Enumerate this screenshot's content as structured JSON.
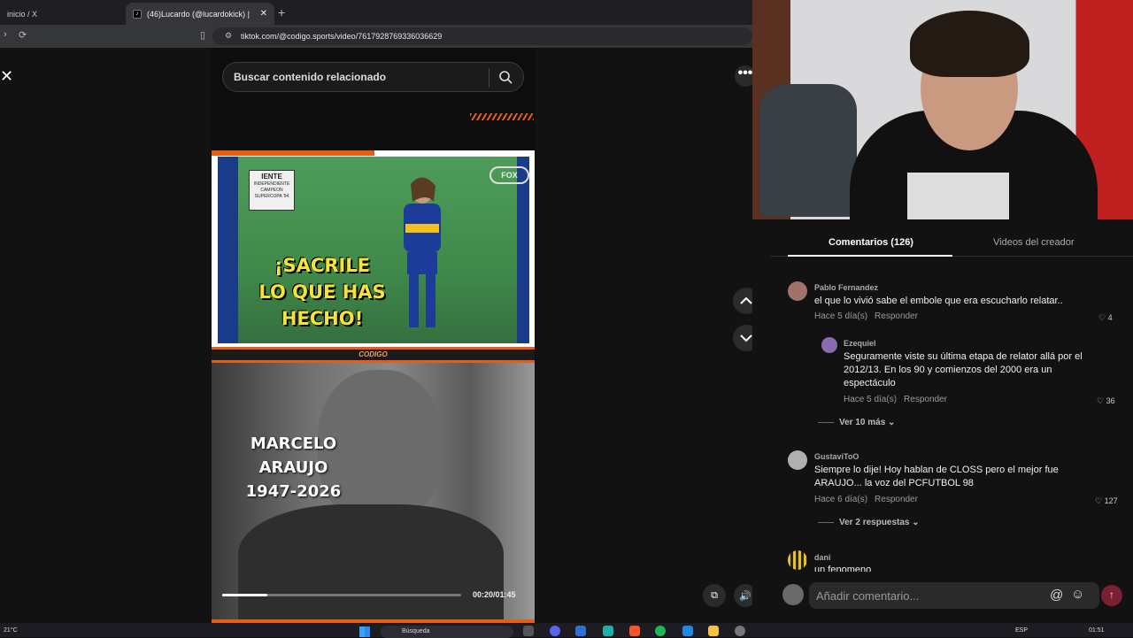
{
  "browser": {
    "tabs": [
      {
        "label": "inicio / X"
      },
      {
        "label": "(46)Lucardo (@lucardokick) |",
        "favicon": "tiktok-icon"
      }
    ],
    "url": "tiktok.com/@codigo.sports/video/7617928769336036629"
  },
  "search": {
    "placeholder": "Buscar contenido relacionado"
  },
  "video": {
    "top_caption": "¡SACRILE\nLO QUE HAS\nHECHO!",
    "scoreboard_team": "IENTE",
    "scoreboard_lines": "INDEPENDIENTE\nCAMPEON\nSUPERCOPA '94",
    "broadcaster": "FOX",
    "brand_bar": "CODIGO",
    "name_caption": "MARCELO\nARAUJO\n1947-2026",
    "time": "00:20/01:45",
    "progress": 0.19
  },
  "comments_panel": {
    "tab_comments": "Comentarios (126)",
    "tab_creator": "Videos del creador",
    "comments": [
      {
        "user": "Pablo Fernandez",
        "text": "el que lo vivió sabe el embole que era escucharlo relatar..",
        "time": "Hace 5 día(s)",
        "reply": "Responder",
        "likes": "4"
      },
      {
        "user": "Ezequiel",
        "text": "Seguramente viste su última etapa de relator allá por el 2012/13. En los 90 y comienzos del 2000 era un espectáculo",
        "time": "Hace 5 día(s)",
        "reply": "Responder",
        "likes": "36"
      },
      {
        "user": "GustaviToO",
        "text": "Siempre lo dije! Hoy hablan de CLOSS pero el mejor fue ARAUJO... la voz del PCFUTBOL 98",
        "time": "Hace 6 día(s)",
        "reply": "Responder",
        "likes": "127"
      },
      {
        "user": "dani",
        "text": "un fenomeno"
      }
    ],
    "more_1": "Ver 10 más",
    "more_2": "Ver 2 respuestas",
    "add_placeholder": "Añadir comentario..."
  },
  "taskbar": {
    "weather": "21°C",
    "search": "Búsqueda",
    "lang": "ESP",
    "clock": "01:51"
  }
}
